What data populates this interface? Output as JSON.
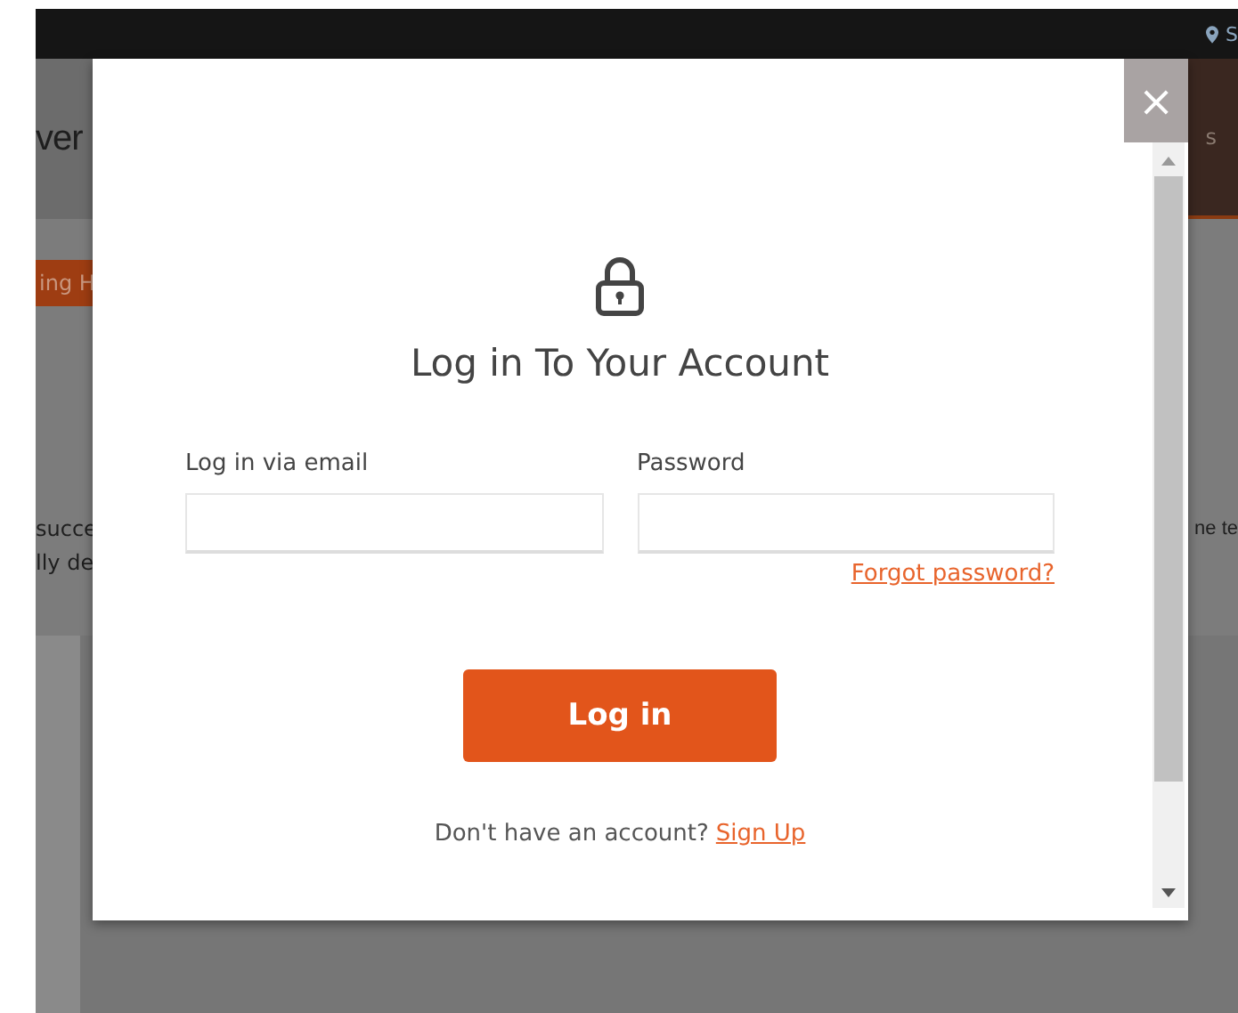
{
  "background": {
    "location_label": "S",
    "header_title": "ver",
    "nav_fragment": "s",
    "tag": "ing H",
    "text_lines": [
      "succe",
      "lly de"
    ],
    "right_text": "ne te"
  },
  "modal": {
    "close": "×",
    "title": "Log in To Your Account",
    "fields": [
      {
        "label": "Log in via email"
      },
      {
        "label": "Password"
      }
    ],
    "forgot_link": "Forgot password?",
    "submit": "Log in",
    "signup_prompt": "Don't have an account?",
    "signup_link": "Sign Up"
  }
}
